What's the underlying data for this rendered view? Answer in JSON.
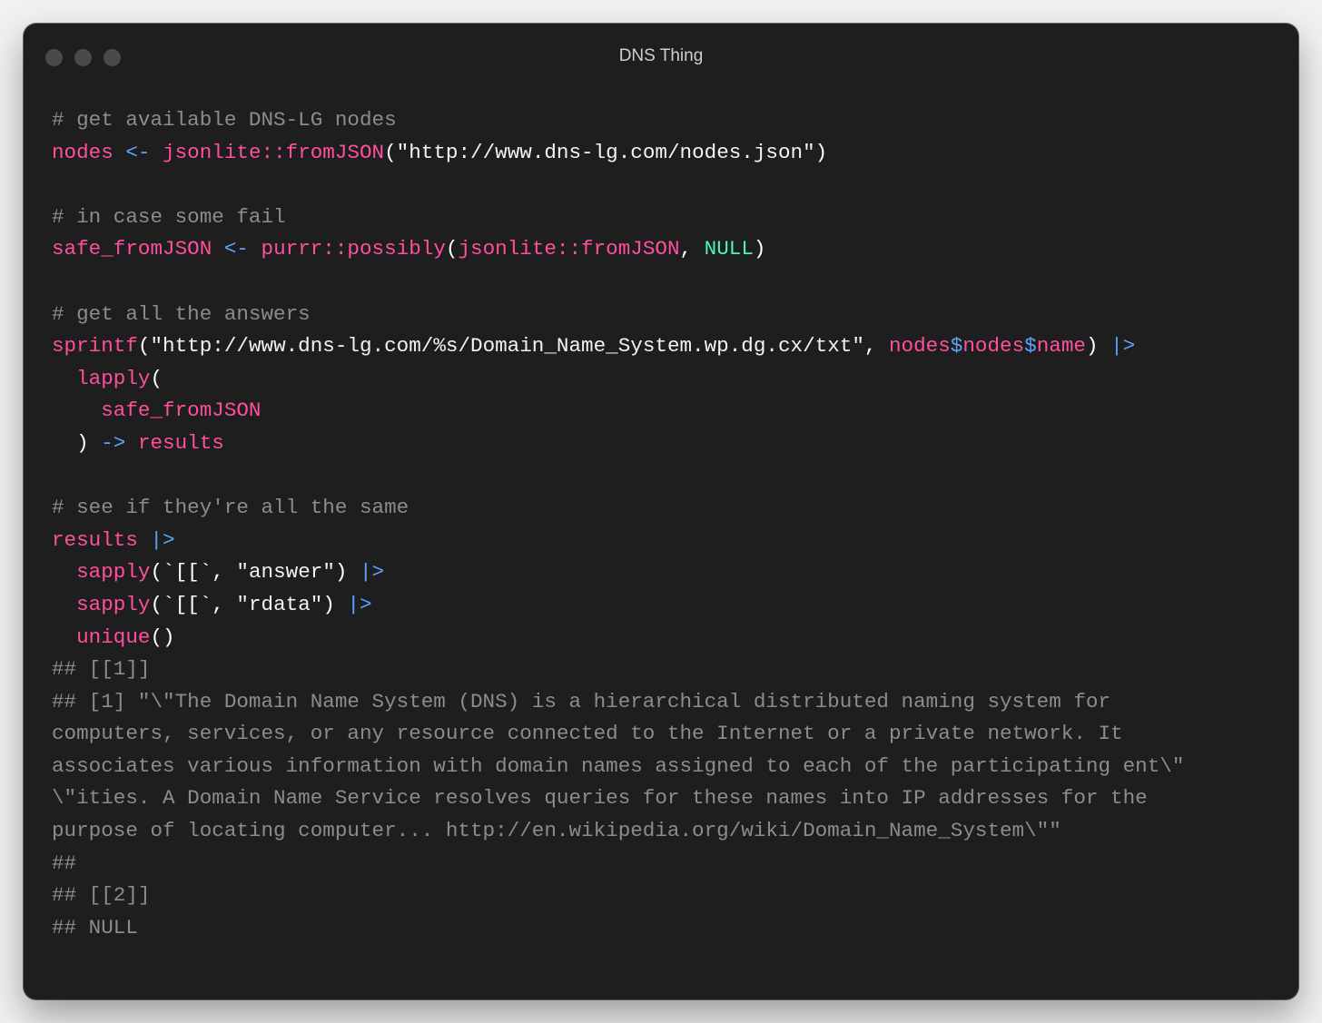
{
  "window": {
    "title": "DNS Thing"
  },
  "code": {
    "l1": {
      "t1": "# get available DNS-LG nodes"
    },
    "l2": {
      "t1": "nodes",
      "t2": " ",
      "t3": "<-",
      "t4": " ",
      "t5": "jsonlite::fromJSON",
      "t6": "(",
      "t7": "\"http://www.dns-lg.com/nodes.json\"",
      "t8": ")"
    },
    "l4": {
      "t1": "# in case some fail"
    },
    "l5": {
      "t1": "safe_fromJSON",
      "t2": " ",
      "t3": "<-",
      "t4": " ",
      "t5": "purrr::possibly",
      "t6": "(",
      "t7": "jsonlite::fromJSON",
      "t8": ", ",
      "t9": "NULL",
      "t10": ")"
    },
    "l7": {
      "t1": "# get all the answers"
    },
    "l8": {
      "t1": "sprintf",
      "t2": "(",
      "t3": "\"http://www.dns-lg.com/%s/Domain_Name_System.wp.dg.cx/txt\"",
      "t4": ", ",
      "t5": "nodes",
      "t6": "$",
      "t7": "nodes",
      "t8": "$",
      "t9": "name",
      "t10": ")",
      "t11": " ",
      "t12": "|>"
    },
    "l9": {
      "t1": "  ",
      "t2": "lapply",
      "t3": "("
    },
    "l10": {
      "t1": "    ",
      "t2": "safe_fromJSON"
    },
    "l11": {
      "t1": "  ",
      "t2": ")",
      "t3": " ",
      "t4": "->",
      "t5": " ",
      "t6": "results"
    },
    "l13": {
      "t1": "# see if they're all the same"
    },
    "l14": {
      "t1": "results",
      "t2": " ",
      "t3": "|>"
    },
    "l15": {
      "t1": "  ",
      "t2": "sapply",
      "t3": "(`[[`, ",
      "t4": "\"answer\"",
      "t5": ")",
      "t6": " ",
      "t7": "|>"
    },
    "l16": {
      "t1": "  ",
      "t2": "sapply",
      "t3": "(`[[`, ",
      "t4": "\"rdata\"",
      "t5": ")",
      "t6": " ",
      "t7": "|>"
    },
    "l17": {
      "t1": "  ",
      "t2": "unique",
      "t3": "()"
    },
    "l18": {
      "t1": "## [[1]]"
    },
    "l19": {
      "t1": "## [1] \"\\\"The Domain Name System (DNS) is a hierarchical distributed naming system for"
    },
    "l20": {
      "t1": "computers, services, or any resource connected to the Internet or a private network. It"
    },
    "l21": {
      "t1": "associates various information with domain names assigned to each of the participating ent\\\""
    },
    "l22": {
      "t1": "\\\"ities. A Domain Name Service resolves queries for these names into IP addresses for the"
    },
    "l23": {
      "t1": "purpose of locating computer... http://en.wikipedia.org/wiki/Domain_Name_System\\\"\""
    },
    "l24": {
      "t1": "##"
    },
    "l25": {
      "t1": "## [[2]]"
    },
    "l26": {
      "t1": "## NULL"
    }
  },
  "colors": {
    "background": "#1e1e1e",
    "comment": "#8c8c8c",
    "identifier": "#ff4f9d",
    "string": "#f3f3f3",
    "null_keyword": "#4ef2c2",
    "operator": "#5ea2ff"
  }
}
